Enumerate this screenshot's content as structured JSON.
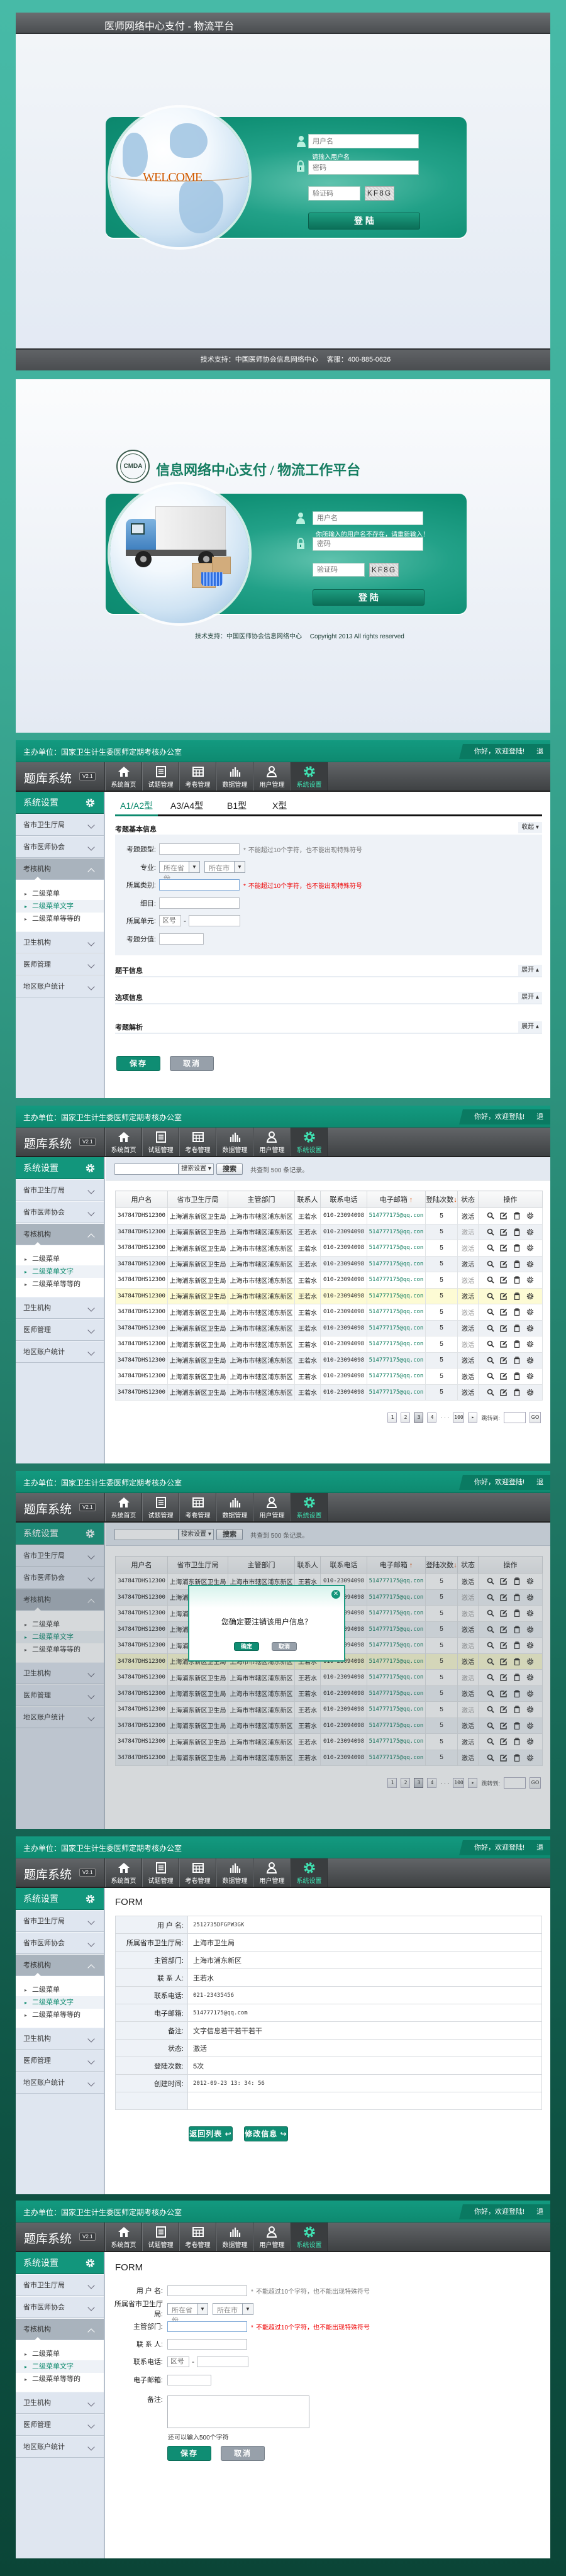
{
  "colors": {
    "brand_green": "#0f8d73",
    "accent_green": "#3fe2b2",
    "error_red": "#e00000",
    "email_green": "#0b7a5c"
  },
  "login1": {
    "title": "医师网络中心支付 - 物流平台",
    "welcome": "WELCOME",
    "username_placeholder": "用户名",
    "username_hint": "请输入用户名",
    "password_placeholder": "密码",
    "captcha_placeholder": "验证码",
    "captcha_code": "KF8G",
    "login_button": "登 陆",
    "footer": "技术支持：中国医师协会信息网络中心　 客服：400-885-0626"
  },
  "login2": {
    "logo_text": "CMDA",
    "title": "信息网络中心支付 / 物流工作平台",
    "username_placeholder": "用户名",
    "username_error": "你所输入的用户名不存在，请重新输入！",
    "password_placeholder": "密码",
    "captcha_placeholder": "验证码",
    "captcha_code": "KF8G",
    "login_button": "登 陆",
    "footer_support": "技术支持：中国医师协会信息网络中心",
    "footer_copyright": "Copyright 2013 All rights reserved"
  },
  "admin": {
    "organizer": "主办单位：国家卫生计生委医师定期考核办公室",
    "welcome": "你好，欢迎登陆!",
    "logout": "退出",
    "brand": "题库系统",
    "version": "V2.1",
    "nav": [
      {
        "label": "系统首页",
        "icon": "home-icon"
      },
      {
        "label": "试题管理",
        "icon": "list-icon"
      },
      {
        "label": "考卷管理",
        "icon": "paper-icon"
      },
      {
        "label": "数据管理",
        "icon": "bar-chart-icon"
      },
      {
        "label": "用户管理",
        "icon": "user-icon"
      },
      {
        "label": "系统设置",
        "icon": "gear-icon"
      }
    ],
    "sidebar": {
      "title": "系统设置",
      "items": [
        "省市卫生厅局",
        "省市医师协会",
        "考核机构",
        "卫生机构",
        "医师管理",
        "地区账户统计"
      ],
      "sub_items": [
        "二级菜单",
        "二级菜单文字",
        "二级菜单等等的"
      ]
    }
  },
  "question_form": {
    "tabs": [
      "A1/A2型",
      "A3/A4型",
      "B1型",
      "X型"
    ],
    "basic_section": "考题基本信息",
    "collapse": "收起",
    "expand": "展开",
    "fields": {
      "type": "考题题型:",
      "major": "专业:",
      "category": "所属类别:",
      "detail": "细目:",
      "unit": "所属单元:",
      "score": "考题分值:"
    },
    "province_select": "所在省份",
    "city_select": "所在市",
    "area_code": "区号",
    "dash": "-",
    "required_mark": "*",
    "hint": "不能超过10个字符，也不能出现特殊符号",
    "sections": [
      "题干信息",
      "选项信息",
      "考题解析"
    ],
    "save": "保存",
    "cancel": "取消"
  },
  "user_list": {
    "search_settings": "搜索设置",
    "search_button": "搜索",
    "result_count": "共查到 500 条记录。",
    "table": {
      "columns": [
        "用户名",
        "省市卫生厅局",
        "主管部门",
        "联系人",
        "联系电话",
        "电子邮箱",
        "登陆次数",
        "状态",
        "操作"
      ],
      "rows": [
        {
          "user": "347847DHS12300",
          "bureau": "上海浦东新区卫生局",
          "dept": "上海市市辖区浦东新区",
          "contact": "王若水",
          "phone": "010-23094098",
          "email": "514777175@qq.con",
          "logins": "5",
          "status": "激活",
          "muted": false,
          "highlighted": false
        },
        {
          "user": "347847DHS12300",
          "bureau": "上海浦东新区卫生局",
          "dept": "上海市市辖区浦东新区",
          "contact": "王若水",
          "phone": "010-23094098",
          "email": "514777175@qq.con",
          "logins": "5",
          "status": "激活",
          "muted": true,
          "highlighted": false
        },
        {
          "user": "347847DHS12300",
          "bureau": "上海浦东新区卫生局",
          "dept": "上海市市辖区浦东新区",
          "contact": "王若水",
          "phone": "010-23094098",
          "email": "514777175@qq.con",
          "logins": "5",
          "status": "激活",
          "muted": true,
          "highlighted": false
        },
        {
          "user": "347847DHS12300",
          "bureau": "上海浦东新区卫生局",
          "dept": "上海市市辖区浦东新区",
          "contact": "王若水",
          "phone": "010-23094098",
          "email": "514777175@qq.con",
          "logins": "5",
          "status": "激活",
          "muted": false,
          "highlighted": false
        },
        {
          "user": "347847DHS12300",
          "bureau": "上海浦东新区卫生局",
          "dept": "上海市市辖区浦东新区",
          "contact": "王若水",
          "phone": "010-23094098",
          "email": "514777175@qq.con",
          "logins": "5",
          "status": "激活",
          "muted": true,
          "highlighted": false
        },
        {
          "user": "347847DHS12300",
          "bureau": "上海浦东新区卫生局",
          "dept": "上海市市辖区浦东新区",
          "contact": "王若水",
          "phone": "010-23094098",
          "email": "514777175@qq.con",
          "logins": "5",
          "status": "激活",
          "muted": false,
          "highlighted": true
        },
        {
          "user": "347847DHS12300",
          "bureau": "上海浦东新区卫生局",
          "dept": "上海市市辖区浦东新区",
          "contact": "王若水",
          "phone": "010-23094098",
          "email": "514777175@qq.con",
          "logins": "5",
          "status": "激活",
          "muted": true,
          "highlighted": false
        },
        {
          "user": "347847DHS12300",
          "bureau": "上海浦东新区卫生局",
          "dept": "上海市市辖区浦东新区",
          "contact": "王若水",
          "phone": "010-23094098",
          "email": "514777175@qq.con",
          "logins": "5",
          "status": "激活",
          "muted": false,
          "highlighted": false
        },
        {
          "user": "347847DHS12300",
          "bureau": "上海浦东新区卫生局",
          "dept": "上海市市辖区浦东新区",
          "contact": "王若水",
          "phone": "010-23094098",
          "email": "514777175@qq.con",
          "logins": "5",
          "status": "激活",
          "muted": true,
          "highlighted": false
        },
        {
          "user": "347847DHS12300",
          "bureau": "上海浦东新区卫生局",
          "dept": "上海市市辖区浦东新区",
          "contact": "王若水",
          "phone": "010-23094098",
          "email": "514777175@qq.con",
          "logins": "5",
          "status": "激活",
          "muted": false,
          "highlighted": false
        },
        {
          "user": "347847DHS12300",
          "bureau": "上海浦东新区卫生局",
          "dept": "上海市市辖区浦东新区",
          "contact": "王若水",
          "phone": "010-23094098",
          "email": "514777175@qq.con",
          "logins": "5",
          "status": "激活",
          "muted": false,
          "highlighted": false
        },
        {
          "user": "347847DHS12300",
          "bureau": "上海浦东新区卫生局",
          "dept": "上海市市辖区浦东新区",
          "contact": "王若水",
          "phone": "010-23094098",
          "email": "514777175@qq.con",
          "logins": "5",
          "status": "激活",
          "muted": false,
          "highlighted": false
        }
      ]
    },
    "pagination": {
      "pages": [
        "1",
        "2",
        "3",
        "4"
      ],
      "current": "3",
      "ellipsis": "· · ·",
      "last": "100",
      "jump_label": "跳转到:",
      "go": "GO"
    }
  },
  "confirm_dialog": {
    "message": "您确定要注销该用户信息？",
    "confirm": "确定",
    "cancel": "取消"
  },
  "user_detail": {
    "title": "FORM",
    "rows": [
      {
        "label": "用 户 名:",
        "value": "2512735DFGPW3GK"
      },
      {
        "label": "所属省市卫生厅局:",
        "value": "上海市卫生局"
      },
      {
        "label": "主管部门:",
        "value": "上海市浦东新区"
      },
      {
        "label": "联 系 人:",
        "value": "王若水"
      },
      {
        "label": "联系电话:",
        "value": "021-23435456"
      },
      {
        "label": "电子邮箱:",
        "value": "514777175@qq.com"
      },
      {
        "label": "备注:",
        "value": "文字信息若干若干若干"
      },
      {
        "label": "状态:",
        "value": "激活"
      },
      {
        "label": "登陆次数:",
        "value": "5次"
      },
      {
        "label": "创建时间:",
        "value": "2012-09-23 13: 34: 56"
      }
    ],
    "back_button": "返回列表",
    "edit_button": "修改信息"
  },
  "user_form": {
    "title": "FORM",
    "fields": {
      "username": "用 户 名:",
      "bureau": "所属省市卫生厅局:",
      "dept": "主管部门:",
      "contact": "联 系 人:",
      "phone": "联系电话:",
      "email": "电子邮箱:",
      "remark": "备注:"
    },
    "province_select": "所在省份",
    "city_select": "所在市",
    "area_code": "区号",
    "dash": "-",
    "required_mark": "*",
    "hint": "不能超过10个字符，也不能出现特殊符号",
    "remaining": "还可以输入500个字符",
    "save": "保存",
    "cancel": "取消"
  }
}
